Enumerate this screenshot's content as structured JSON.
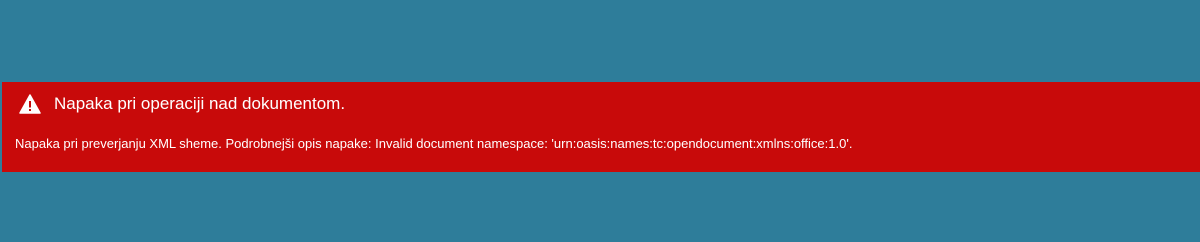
{
  "error": {
    "icon": "warning-icon",
    "title": "Napaka pri operaciji nad dokumentom.",
    "message": "Napaka pri preverjanju XML sheme. Podrobnejši opis napake: Invalid document namespace: 'urn:oasis:names:tc:opendocument:xmlns:office:1.0'.",
    "background_color": "#c80a0a",
    "text_color": "#ffffff"
  },
  "page": {
    "background_color": "#2e7d9a"
  }
}
